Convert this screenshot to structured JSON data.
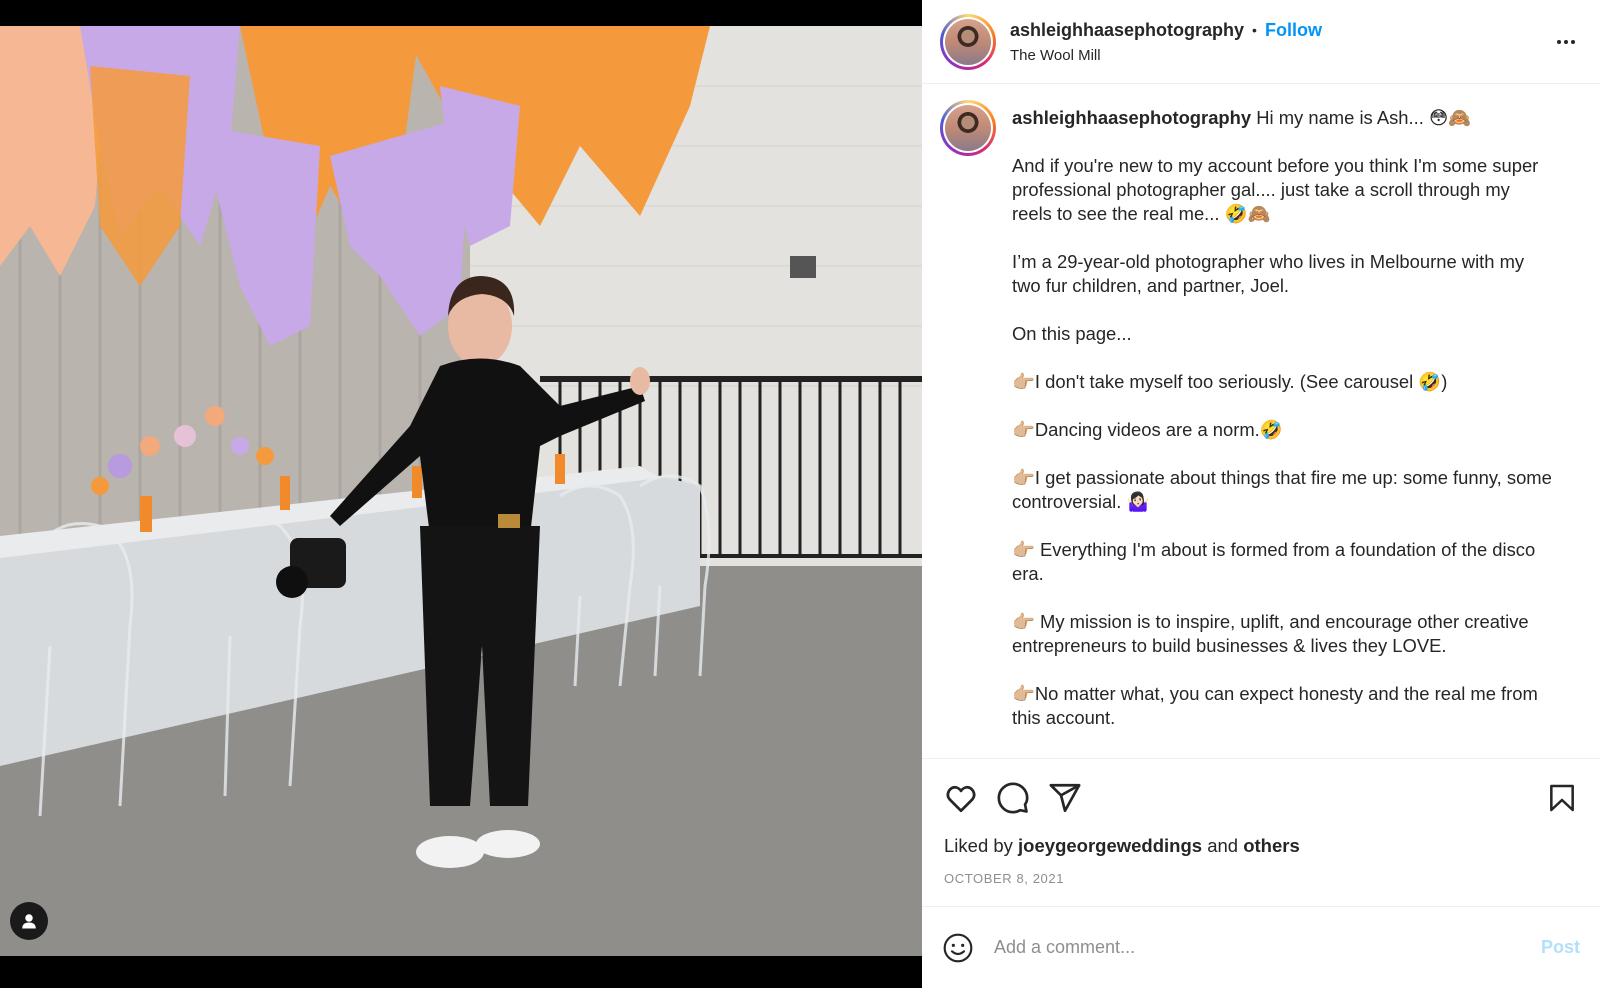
{
  "post": {
    "username": "ashleighhaasephotography",
    "follow_label": "Follow",
    "location": "The Wool Mill"
  },
  "caption": {
    "username": "ashleighhaasephotography",
    "paragraphs": [
      "Hi my name is Ash... 😳🙈",
      "And if you're new to my account before you think I'm some super professional photographer gal.... just take a scroll through my reels to see the real me... 🤣🙈",
      "I’m a 29-year-old photographer who lives in Melbourne with my two fur children, and partner, Joel.",
      "On this page...",
      "👉🏼I don't take myself too seriously. (See carousel 🤣)",
      "👉🏼Dancing videos are a norm.🤣",
      "👉🏼I get passionate about things that fire me up: some funny, some controversial. 🤷🏻‍♀️",
      "👉🏼 Everything I'm about is formed from a foundation of the disco era.",
      "👉🏼 My mission is to inspire, uplift, and encourage other creative entrepreneurs to build businesses & lives they LOVE.",
      "👉🏼No matter what, you can expect honesty and the real me from this account."
    ]
  },
  "actions": {
    "icons": [
      "heart-icon",
      "comment-icon",
      "share-icon",
      "bookmark-icon"
    ]
  },
  "likes": {
    "prefix": "Liked by",
    "user": "joeygeorgeweddings",
    "joiner": "and",
    "others": "others"
  },
  "date": "OCTOBER 8, 2021",
  "comment": {
    "placeholder": "Add a comment...",
    "post_label": "Post"
  },
  "colors": {
    "accent": "#0095f6",
    "post_disabled": "#b2dffc",
    "muted": "#8e8e8e"
  }
}
